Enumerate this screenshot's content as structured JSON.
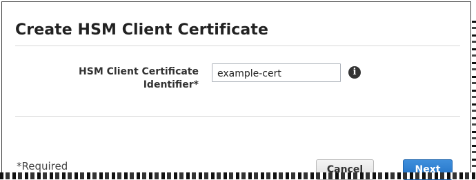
{
  "dialog": {
    "title": "Create HSM Client Certificate",
    "field": {
      "label": "HSM Client Certificate Identifier*",
      "value": "example-cert"
    },
    "info_icon": "info-icon",
    "required_note": "*Required",
    "buttons": {
      "cancel_label": "Cancel",
      "next_label": "Next"
    }
  },
  "colors": {
    "primary_button": "#2a7bd0",
    "secondary_button": "#e6e6e6",
    "border": "#3a3a3a"
  }
}
